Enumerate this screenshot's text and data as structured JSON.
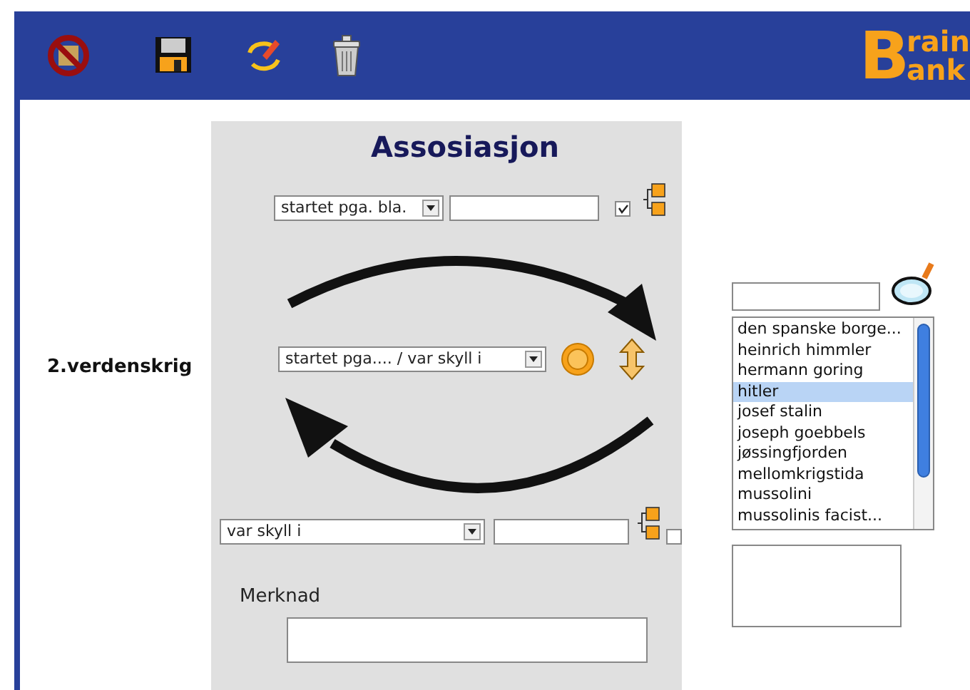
{
  "logo": {
    "initial": "B",
    "lines": [
      "rain",
      "ank"
    ]
  },
  "subject": {
    "label": "2.verdenskrig"
  },
  "association": {
    "title": "Assosiasjon",
    "top_relation": {
      "select": "startet pga. bla.",
      "checked": true
    },
    "middle_relation": {
      "select": "startet pga.... / var skyll i"
    },
    "bottom_relation": {
      "select": "var skyll i",
      "checked": false
    },
    "note_label": "Merknad"
  },
  "search_list": {
    "items": [
      {
        "label": "den spanske borge...",
        "selected": false
      },
      {
        "label": "heinrich himmler",
        "selected": false
      },
      {
        "label": "hermann goring",
        "selected": false
      },
      {
        "label": "hitler",
        "selected": true
      },
      {
        "label": "josef stalin",
        "selected": false
      },
      {
        "label": "joseph goebbels",
        "selected": false
      },
      {
        "label": "jøssingfjorden",
        "selected": false
      },
      {
        "label": "mellomkrigstida",
        "selected": false
      },
      {
        "label": "mussolini",
        "selected": false
      },
      {
        "label": "mussolinis facist...",
        "selected": false
      }
    ]
  }
}
